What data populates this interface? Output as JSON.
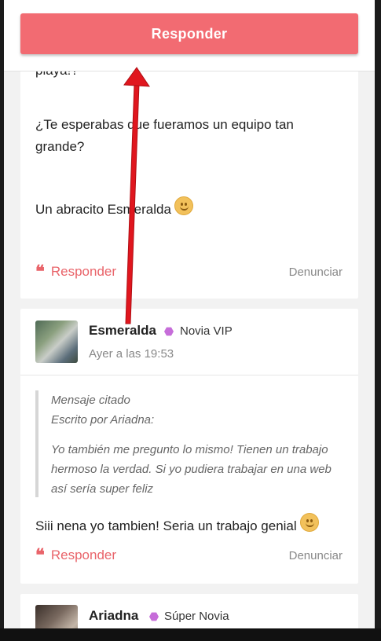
{
  "header": {
    "reply_button_label": "Responder"
  },
  "posts": [
    {
      "lines": [
        "playa!?",
        "¿Te esperabas que fueramos un equipo tan",
        "grande?",
        "Un abracito Esmeralda"
      ],
      "reply_label": "Responder",
      "report_label": "Denunciar"
    },
    {
      "author": "Esmeralda",
      "badge": "Novia VIP",
      "time": "Ayer a las 19:53",
      "quote": {
        "title": "Mensaje citado",
        "by": "Escrito por Ariadna:",
        "lines": [
          "Yo también me pregunto lo mismo! Tienen un trabajo",
          "hermoso la verdad. Si yo pudiera trabajar en una web",
          "así sería super feliz"
        ]
      },
      "text": "Siii nena yo tambien! Seria un trabajo genial",
      "reply_label": "Responder",
      "report_label": "Denunciar"
    },
    {
      "author": "Ariadna",
      "badge": "Súper Novia"
    }
  ],
  "colors": {
    "accent": "#f26b72",
    "badge": "#c66dd9",
    "arrow": "#e0161e"
  },
  "icons": [
    "quote-icon",
    "smiley-emoji-icon",
    "hexagon-badge-icon"
  ]
}
